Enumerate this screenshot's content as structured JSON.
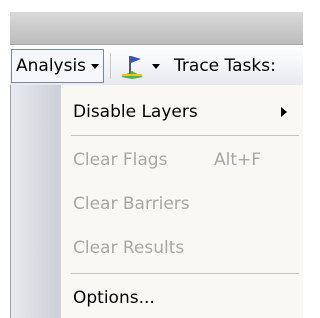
{
  "toolbar": {
    "analysis_menu_label": "Analysis",
    "flag_icon": "flag-tool-icon",
    "trace_tasks_label": "Trace Tasks:"
  },
  "dropdown": {
    "items": [
      {
        "label": "Disable Layers",
        "shortcut": "",
        "enabled": true,
        "has_submenu": true
      },
      {
        "label": "Clear Flags",
        "shortcut": "Alt+F",
        "enabled": false,
        "has_submenu": false
      },
      {
        "label": "Clear Barriers",
        "shortcut": "",
        "enabled": false,
        "has_submenu": false
      },
      {
        "label": "Clear Results",
        "shortcut": "",
        "enabled": false,
        "has_submenu": false
      },
      {
        "label": "Options...",
        "shortcut": "",
        "enabled": true,
        "has_submenu": false
      }
    ]
  },
  "colors": {
    "disabled_text": "#a7a7a7",
    "flag_blue": "#2b55c8",
    "flag_green": "#3aa23a",
    "flag_yellow": "#f2c21c"
  }
}
